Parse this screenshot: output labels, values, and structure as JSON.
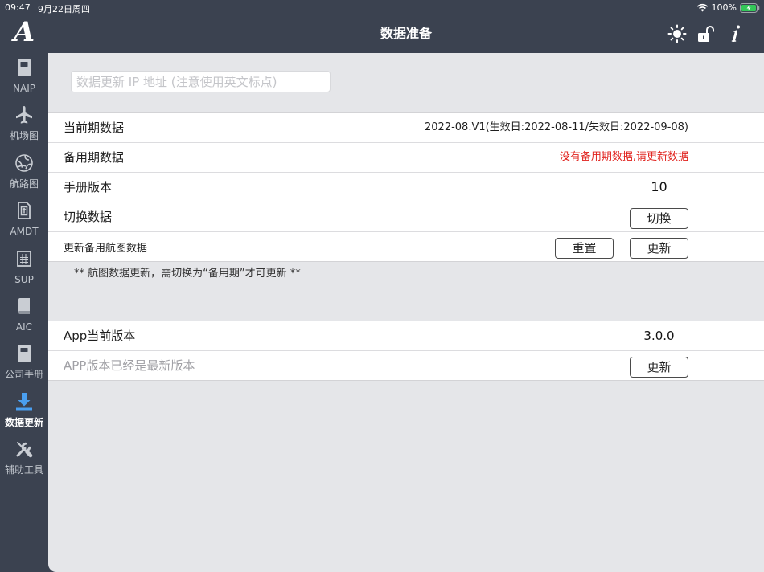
{
  "status_bar": {
    "time": "09:47",
    "date": "9月22日周四",
    "battery": "100%",
    "icons": [
      "wifi-icon",
      "battery-icon"
    ]
  },
  "header": {
    "title": "数据准备",
    "icons": [
      "brightness-icon",
      "unlock-icon",
      "info-icon"
    ]
  },
  "sidebar": {
    "logo": "A",
    "items": [
      {
        "label": "NAIP",
        "icon": "naip-book-icon",
        "selected": false
      },
      {
        "label": "机场图",
        "icon": "airplane-icon",
        "selected": false
      },
      {
        "label": "航路图",
        "icon": "globe-icon",
        "selected": false
      },
      {
        "label": "AMDT",
        "icon": "amendment-doc-icon",
        "selected": false
      },
      {
        "label": "SUP",
        "icon": "grid-doc-icon",
        "selected": false
      },
      {
        "label": "AIC",
        "icon": "book-icon",
        "selected": false
      },
      {
        "label": "公司手册",
        "icon": "manual-icon",
        "selected": false
      },
      {
        "label": "数据更新",
        "icon": "download-icon",
        "selected": true
      },
      {
        "label": "辅助工具",
        "icon": "tools-icon",
        "selected": false
      }
    ]
  },
  "ip_input": {
    "value": "",
    "placeholder": "数据更新 IP 地址 (注意使用英文标点)"
  },
  "data_section": {
    "current_label": "当前期数据",
    "current_value": "2022-08.V1(生效日:2022-08-11/失效日:2022-09-08)",
    "backup_label": "备用期数据",
    "backup_value": "没有备用期数据,请更新数据",
    "manual_label": "手册版本",
    "manual_value": "10",
    "switch_label": "切换数据",
    "switch_button": "切换",
    "update_label": "更新备用航图数据",
    "reset_button": "重置",
    "update_button": "更新"
  },
  "note": "** 航图数据更新，需切换为“备用期”才可更新 **",
  "app_section": {
    "version_label": "App当前版本",
    "version_value": "3.0.0",
    "status_label": "APP版本已经是最新版本",
    "update_button": "更新"
  },
  "colors": {
    "chrome_bg": "#3b4250",
    "content_bg": "#e5e6e9",
    "accent": "#4a9ff0",
    "warning": "#e0201b",
    "battery": "#34c759"
  }
}
